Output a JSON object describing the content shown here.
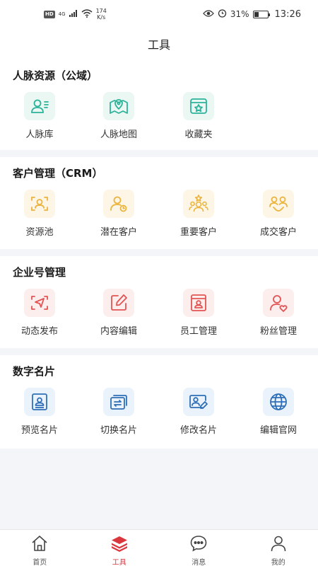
{
  "status_bar": {
    "hd": "HD",
    "signal": "4G",
    "speed_value": "174",
    "speed_unit": "K/s",
    "battery": "31%",
    "battery_level": 0.31,
    "time": "13:26"
  },
  "header": {
    "title": "工具"
  },
  "sections": [
    {
      "title": "人脉资源（公域）",
      "items": [
        {
          "label": "人脉库",
          "icon": "contacts-icon"
        },
        {
          "label": "人脉地图",
          "icon": "map-pin-icon"
        },
        {
          "label": "收藏夹",
          "icon": "favorites-icon"
        }
      ]
    },
    {
      "title": "客户管理（CRM）",
      "items": [
        {
          "label": "资源池",
          "icon": "scan-face-icon"
        },
        {
          "label": "潜在客户",
          "icon": "potential-customer-icon"
        },
        {
          "label": "重要客户",
          "icon": "vip-customer-icon"
        },
        {
          "label": "成交客户",
          "icon": "deal-customer-icon"
        }
      ]
    },
    {
      "title": "企业号管理",
      "items": [
        {
          "label": "动态发布",
          "icon": "send-icon"
        },
        {
          "label": "内容编辑",
          "icon": "edit-icon"
        },
        {
          "label": "员工管理",
          "icon": "employee-icon"
        },
        {
          "label": "粉丝管理",
          "icon": "fans-icon"
        }
      ]
    },
    {
      "title": "数字名片",
      "items": [
        {
          "label": "预览名片",
          "icon": "card-preview-icon"
        },
        {
          "label": "切换名片",
          "icon": "card-switch-icon"
        },
        {
          "label": "修改名片",
          "icon": "card-edit-icon"
        },
        {
          "label": "编辑官网",
          "icon": "globe-icon"
        }
      ]
    }
  ],
  "tabs": [
    {
      "label": "首页",
      "icon": "home-icon"
    },
    {
      "label": "工具",
      "icon": "tools-layers-icon",
      "active": true
    },
    {
      "label": "消息",
      "icon": "message-icon"
    },
    {
      "label": "我的",
      "icon": "user-icon"
    }
  ],
  "colors": {
    "green": "#2bb39a",
    "yellow": "#ebb43e",
    "red": "#e25454",
    "blue": "#2e6fb7",
    "active_tab": "#d9363e"
  }
}
